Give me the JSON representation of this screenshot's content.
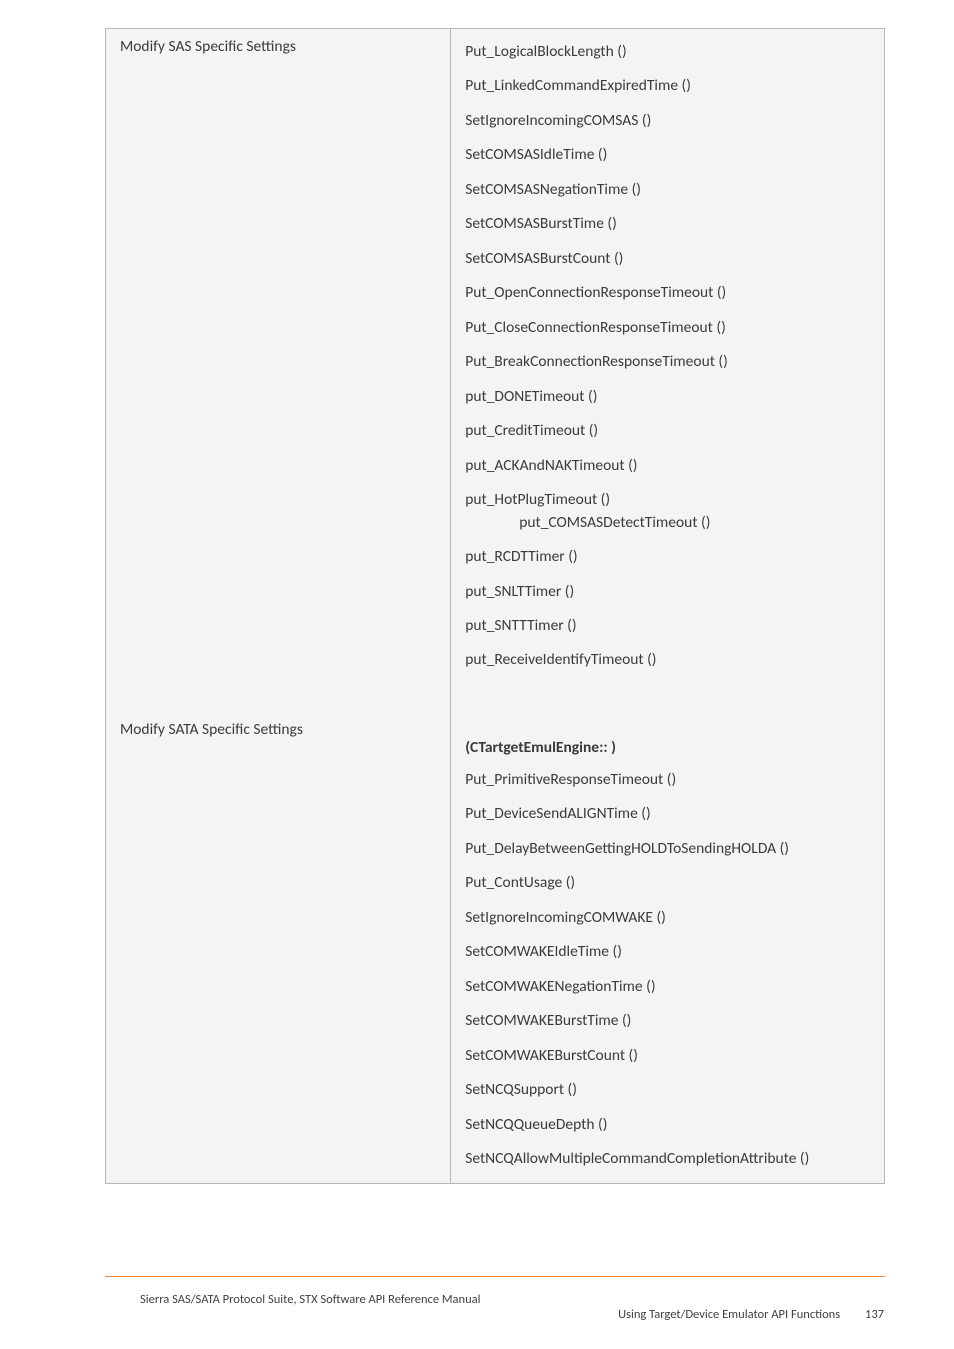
{
  "table": {
    "row1": {
      "label": "Modify SAS Specific Settings",
      "items": [
        "Put_LogicalBlockLength ()",
        "Put_LinkedCommandExpiredTime ()",
        "SetIgnoreIncomingCOMSAS ()",
        "SetCOMSASIdleTime ()",
        "SetCOMSASNegationTime ()",
        "SetCOMSASBurstTime ()",
        "SetCOMSASBurstCount ()",
        "Put_OpenConnectionResponseTimeout ()",
        "Put_CloseConnectionResponseTimeout ()",
        "Put_BreakConnectionResponseTimeout ()",
        "put_DONETimeout ()",
        "put_CreditTimeout ()",
        "put_ACKAndNAKTimeout ()",
        "put_HotPlugTimeout ()",
        "put_COMSASDetectTimeout ()",
        "put_RCDTTimer ()",
        "put_SNLTTimer ()",
        "put_SNTTTimer ()",
        "put_ReceiveIdentifyTimeout ()"
      ]
    },
    "row2": {
      "label": "Modify SATA Specific Settings",
      "heading": "(CTartgetEmulEngine:: )",
      "items": [
        "Put_PrimitiveResponseTimeout ()",
        "Put_DeviceSendALIGNTime ()",
        "Put_DelayBetweenGettingHOLDToSendingHOLDA ()",
        "Put_ContUsage ()",
        "SetIgnoreIncomingCOMWAKE ()",
        "SetCOMWAKEIdleTime ()",
        "SetCOMWAKENegationTime ()",
        "SetCOMWAKEBurstTime ()",
        "SetCOMWAKEBurstCount ()",
        "SetNCQSupport ()",
        "SetNCQQueueDepth ()",
        "SetNCQAllowMultipleCommandCompletionAttribute ()"
      ]
    }
  },
  "footer": {
    "left": "Sierra SAS/SATA Protocol Suite, STX Software API Reference Manual",
    "right": "Using Target/Device Emulator API Functions",
    "page": "137"
  }
}
